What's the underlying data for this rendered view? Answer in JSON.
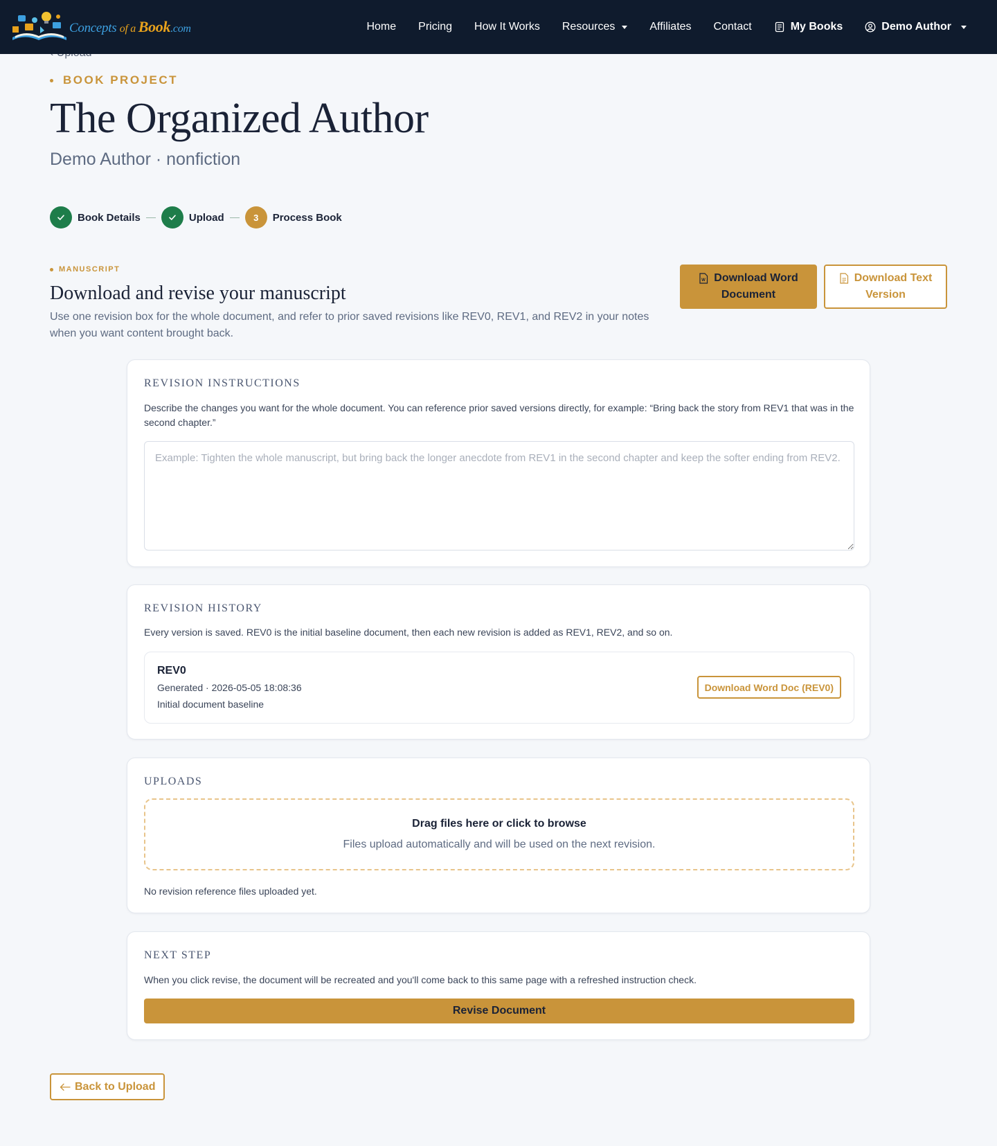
{
  "brand": {
    "part1": "Concepts ",
    "part2": "of a ",
    "part3": "Book",
    "part4": ".com",
    "colors": {
      "blue": "#3da0e0",
      "gold": "#e8a21c"
    }
  },
  "nav": {
    "home": "Home",
    "pricing": "Pricing",
    "how_it_works": "How It Works",
    "resources": "Resources",
    "affiliates": "Affiliates",
    "contact": "Contact",
    "my_books": "My Books",
    "user": "Demo Author"
  },
  "header": {
    "back_crumb": "Upload",
    "eyebrow": "BOOK PROJECT",
    "title": "The Organized Author",
    "subtitle": "Demo Author · nonfiction"
  },
  "stepper": {
    "steps": [
      {
        "label": "Book Details",
        "state": "done"
      },
      {
        "label": "Upload",
        "state": "done"
      },
      {
        "label": "Process Book",
        "state": "active",
        "number": "3"
      }
    ]
  },
  "manuscript": {
    "eyebrow": "MANUSCRIPT",
    "title": "Download and revise your manuscript",
    "description": "Use one revision box for the whole document, and refer to prior saved revisions like REV0, REV1, and REV2 in your notes when you want content brought back.",
    "download_word_line1": "Download Word",
    "download_word_line2": "Document",
    "download_text_line1": "Download Text",
    "download_text_line2": "Version"
  },
  "instructions": {
    "title": "REVISION INSTRUCTIONS",
    "text": "Describe the changes you want for the whole document. You can reference prior saved versions directly, for example: “Bring back the story from REV1 that was in the second chapter.”",
    "value": "",
    "placeholder": "Example: Tighten the whole manuscript, but bring back the longer anecdote from REV1 in the second chapter and keep the softer ending from REV2."
  },
  "history": {
    "title": "REVISION HISTORY",
    "text": "Every version is saved. REV0 is the initial baseline document, then each new revision is added as REV1, REV2, and so on.",
    "items": [
      {
        "name": "REV0",
        "meta": "Generated · 2026-05-05 18:08:36",
        "note": "Initial document baseline",
        "download_label": "Download Word Doc (REV0)"
      }
    ]
  },
  "uploads": {
    "title": "UPLOADS",
    "drop_title": "Drag files here or click to browse",
    "drop_sub": "Files upload automatically and will be used on the next revision.",
    "empty": "No revision reference files uploaded yet."
  },
  "next_step": {
    "title": "NEXT STEP",
    "text": "When you click revise, the document will be recreated and you'll come back to this same page with a refreshed instruction check.",
    "button": "Revise Document"
  },
  "footer": {
    "back_button": "Back to Upload"
  },
  "colors": {
    "navy": "#0f1b2d",
    "gold": "#c9943a",
    "green": "#1e7d4a",
    "text": "#1a2236",
    "muted": "#5e6b82"
  },
  "icons": {
    "word_doc": "word-document-icon",
    "text_doc": "text-document-icon",
    "books": "book-list-icon",
    "user": "user-circle-icon",
    "check": "check-icon",
    "arrow_left": "arrow-left-icon"
  }
}
